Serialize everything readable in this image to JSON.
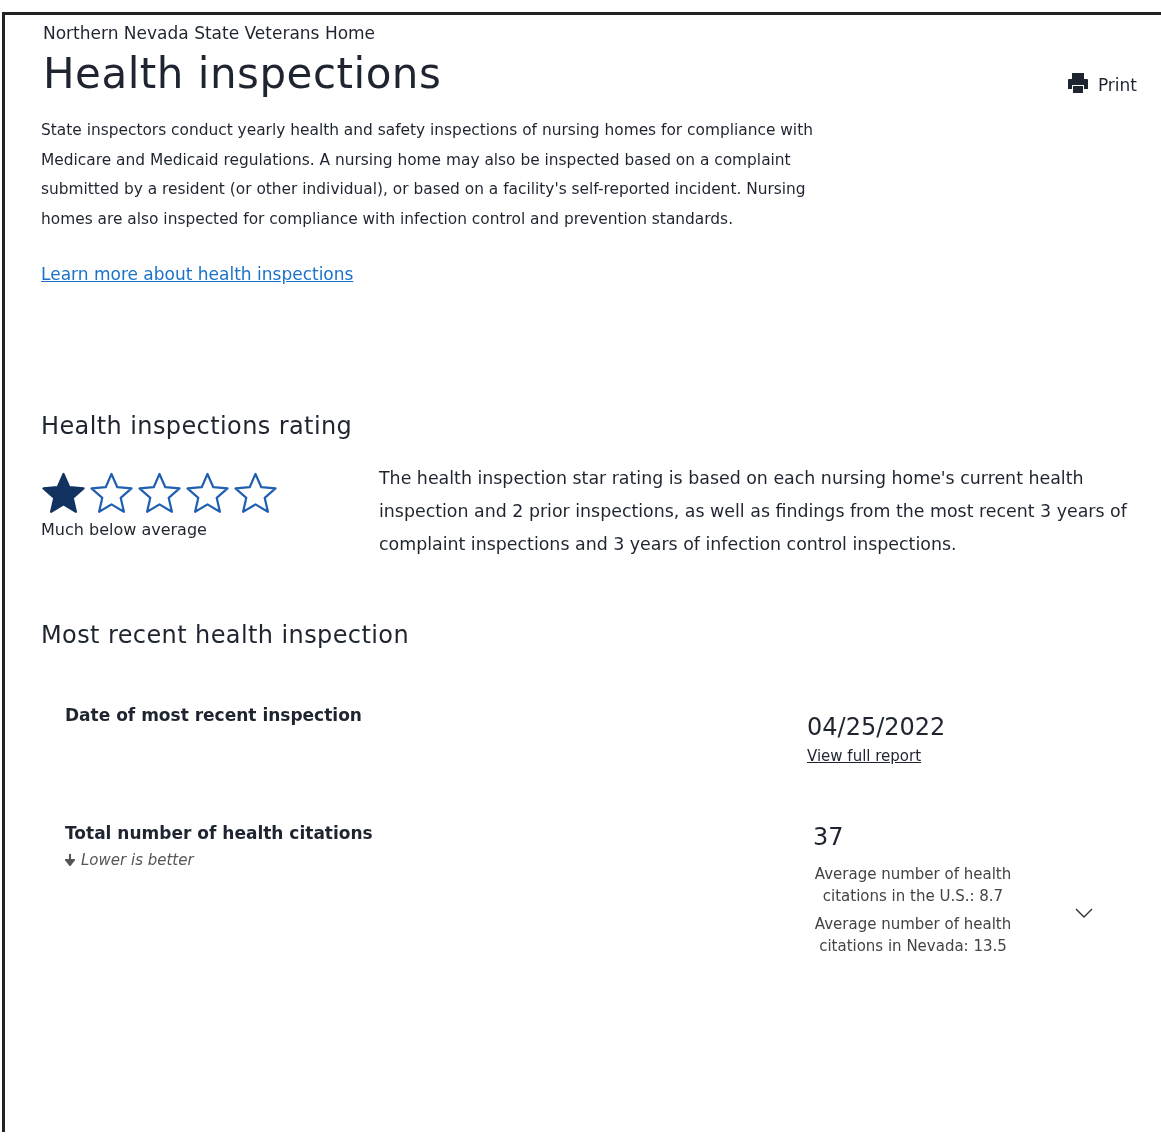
{
  "facility_name": "Northern Nevada State Veterans Home",
  "title": "Health inspections",
  "print_button": {
    "label": "Print"
  },
  "intro": "State inspectors conduct yearly health and safety inspections of nursing homes for compliance with Medicare and Medicaid regulations. A nursing home may also be inspected based on a complaint submitted by a resident (or other individual), or based on a facility's self-reported incident. Nursing homes are also inspected for compliance with infection control and prevention standards.",
  "learn_more_link": "Learn more about health inspections",
  "rating": {
    "heading": "Health inspections rating",
    "stars": 1,
    "label": "Much below average",
    "description": "The health inspection star rating is based on each nursing home's current health inspection and 2 prior inspections, as well as findings from the most recent 3 years of complaint inspections and 3 years of infection control inspections."
  },
  "recent": {
    "heading": "Most recent health inspection",
    "rows": [
      {
        "kind": "date",
        "label": "Date of most recent inspection",
        "value": "04/25/2022",
        "link": "View full report"
      },
      {
        "kind": "citations",
        "label": "Total number of health citations",
        "hint": "Lower is better",
        "value": "37",
        "averages": [
          "Average number of health citations in the U.S.: 8.7",
          "Average number of health citations in Nevada: 13.5"
        ]
      }
    ]
  }
}
